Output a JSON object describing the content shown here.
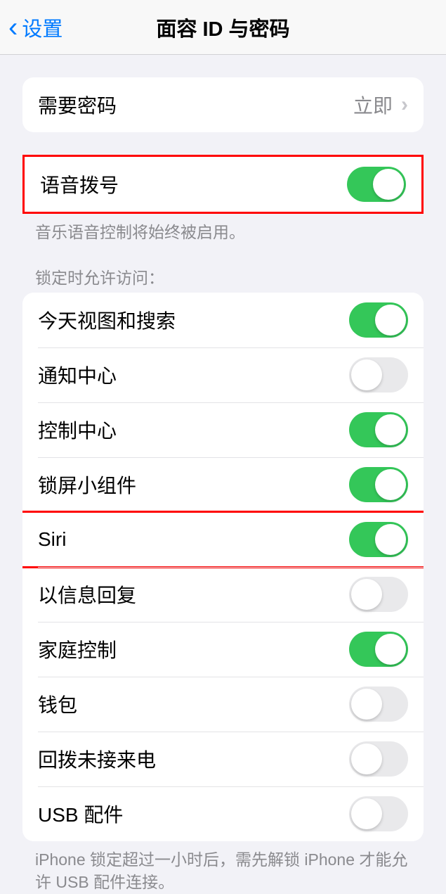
{
  "nav": {
    "back_label": "设置",
    "title": "面容 ID 与密码"
  },
  "passcode_row": {
    "label": "需要密码",
    "value": "立即"
  },
  "voice_dial": {
    "label": "语音拨号",
    "enabled": true
  },
  "voice_dial_footer": "音乐语音控制将始终被启用。",
  "lock_header": "锁定时允许访问：",
  "lock_items": [
    {
      "label": "今天视图和搜索",
      "enabled": true
    },
    {
      "label": "通知中心",
      "enabled": false
    },
    {
      "label": "控制中心",
      "enabled": true
    },
    {
      "label": "锁屏小组件",
      "enabled": true
    },
    {
      "label": "Siri",
      "enabled": true,
      "highlighted": true
    },
    {
      "label": "以信息回复",
      "enabled": false
    },
    {
      "label": "家庭控制",
      "enabled": true
    },
    {
      "label": "钱包",
      "enabled": false
    },
    {
      "label": "回拨未接来电",
      "enabled": false
    },
    {
      "label": "USB 配件",
      "enabled": false
    }
  ],
  "usb_footer": "iPhone 锁定超过一小时后，需先解锁 iPhone 才能允许 USB 配件连接。"
}
